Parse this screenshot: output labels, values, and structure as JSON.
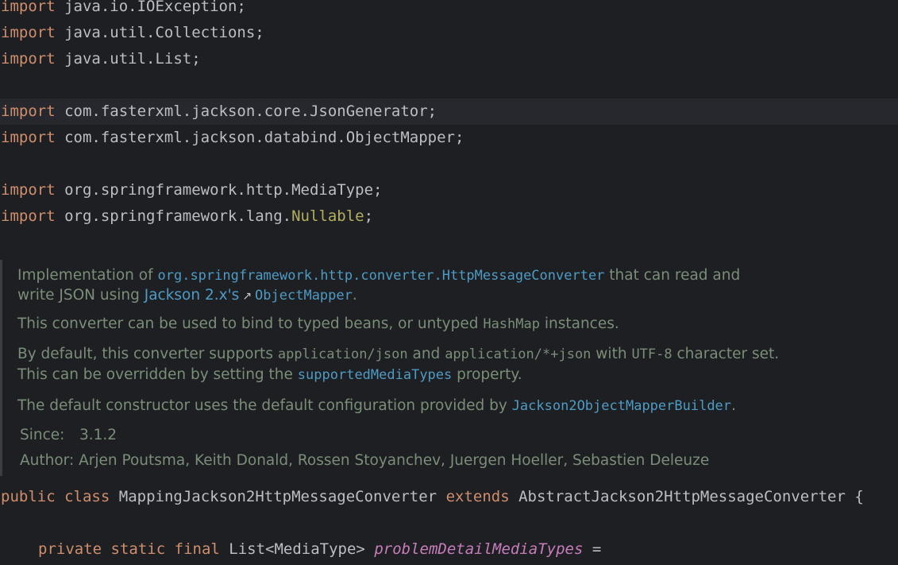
{
  "imports": [
    {
      "keyword": "import",
      "path": "java.io.IOException;"
    },
    {
      "keyword": "import",
      "path": "java.util.Collections;"
    },
    {
      "keyword": "import",
      "path": "java.util.List;"
    },
    {
      "keyword": "import",
      "path": "com.fasterxml.jackson.core.JsonGenerator;"
    },
    {
      "keyword": "import",
      "path": "com.fasterxml.jackson.databind.ObjectMapper;"
    },
    {
      "keyword": "import",
      "path": "org.springframework.http.MediaType;"
    },
    {
      "keyword": "import",
      "path_prefix": "org.springframework.lang.",
      "annotation": "Nullable",
      "suffix": ";"
    }
  ],
  "doc": {
    "p1": {
      "pre": "Implementation of ",
      "link": "org.springframework.http.converter.HttpMessageConverter",
      "post": " that can read and"
    },
    "p1b": {
      "pre": "write JSON using ",
      "link_prose": "Jackson 2.x's",
      "link": "ObjectMapper",
      "post": "."
    },
    "p2": {
      "pre": "This converter can be used to bind to typed beans, or untyped ",
      "code": "HashMap",
      "post": " instances."
    },
    "p3": {
      "pre": "By default, this converter supports ",
      "code1": "application/json",
      "mid1": " and ",
      "code2": "application/*+json",
      "mid2": " with ",
      "code3": "UTF-8",
      "post": " character set."
    },
    "p3b": {
      "pre": "This can be overridden by setting the ",
      "link": "supportedMediaTypes",
      "post": " property."
    },
    "p4": {
      "pre": "The default constructor uses the default configuration provided by ",
      "link": "Jackson2ObjectMapperBuilder",
      "post": "."
    },
    "since_label": "Since:",
    "since_value": "3.1.2",
    "author_label": "Author:",
    "author_value": "Arjen Poutsma, Keith Donald, Rossen Stoyanchev, Juergen Hoeller, Sebastien Deleuze"
  },
  "class_decl": {
    "kw1": "public",
    "kw2": "class",
    "name": "MappingJackson2HttpMessageConverter",
    "kw3": "extends",
    "parent": "AbstractJackson2HttpMessageConverter",
    "tail": " {"
  },
  "field_decl": {
    "kw1": "private",
    "kw2": "static",
    "kw3": "final",
    "type": "List<MediaType>",
    "name": "problemDetailMediaTypes",
    "tail": " ="
  },
  "colors": {
    "background": "#1e1f22",
    "keyword": "#cf8e6d",
    "text": "#bcbec4",
    "annotation": "#b3ae60",
    "field": "#c77dbb",
    "doc_text": "#7a8e78",
    "doc_link": "#4e9bc4"
  }
}
